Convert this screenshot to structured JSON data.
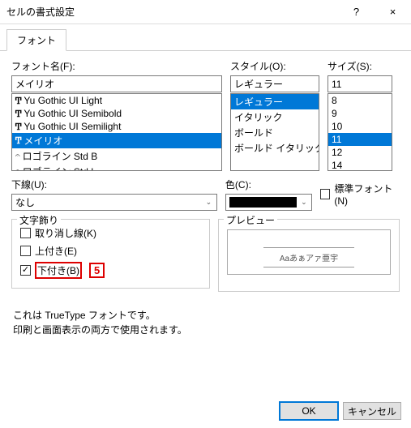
{
  "window": {
    "title": "セルの書式設定",
    "help": "?",
    "close": "×"
  },
  "tabs": {
    "active": "フォント"
  },
  "font": {
    "label": "フォント名(F):",
    "value": "メイリオ",
    "items": [
      {
        "icon": "T",
        "name": "Yu Gothic UI Light"
      },
      {
        "icon": "T",
        "name": "Yu Gothic UI Semibold"
      },
      {
        "icon": "T",
        "name": "Yu Gothic UI Semilight"
      },
      {
        "icon": "T",
        "name": "メイリオ",
        "selected": true
      },
      {
        "icon": "O",
        "name": "ロゴライン Std B"
      },
      {
        "icon": "O",
        "name": "ロゴライン Std L"
      }
    ]
  },
  "style": {
    "label": "スタイル(O):",
    "value": "レギュラー",
    "items": [
      "レギュラー",
      "イタリック",
      "ボールド",
      "ボールド イタリック"
    ],
    "selected": "レギュラー"
  },
  "size": {
    "label": "サイズ(S):",
    "value": "11",
    "items": [
      "8",
      "9",
      "10",
      "11",
      "12",
      "14"
    ],
    "selected": "11"
  },
  "underline": {
    "label": "下線(U):",
    "value": "なし"
  },
  "color": {
    "label": "色(C):",
    "value": "#000000"
  },
  "normal": {
    "label": "標準フォント(N)",
    "checked": false
  },
  "effects": {
    "legend": "文字飾り",
    "strike": {
      "label": "取り消し線(K)",
      "checked": false
    },
    "super": {
      "label": "上付き(E)",
      "checked": false
    },
    "sub": {
      "label": "下付き(B)",
      "checked": true
    }
  },
  "preview": {
    "legend": "プレビュー",
    "text": "Aaあぁアァ亜宇"
  },
  "callout": "5",
  "desc1": "これは TrueType フォントです。",
  "desc2": "印刷と画面表示の両方で使用されます。",
  "buttons": {
    "ok": "OK",
    "cancel": "キャンセル"
  }
}
